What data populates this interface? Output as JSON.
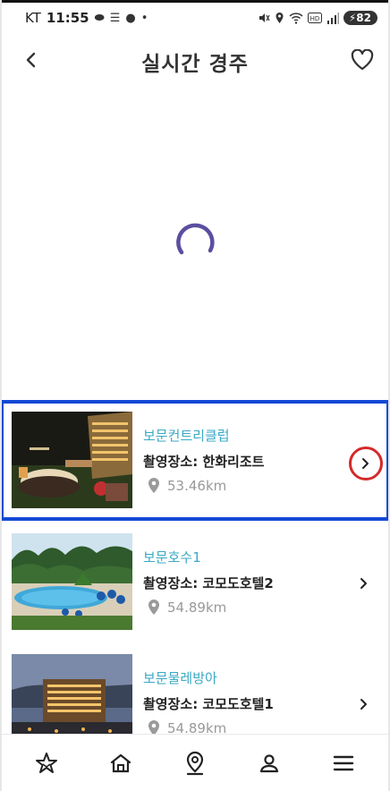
{
  "status_bar": {
    "carrier": "KT",
    "time": "11:55",
    "battery": "82"
  },
  "header": {
    "title": "실시간 경주",
    "back_icon": "chevron-left-icon",
    "favorite_icon": "heart-outline-icon"
  },
  "player": {
    "loading": true,
    "spinner_color": "#5a4fa0"
  },
  "places": [
    {
      "name": "보문컨트리클럽",
      "location": "촬영장소: 한화리조트",
      "distance": "53.46km",
      "selected": true
    },
    {
      "name": "보문호수1",
      "location": "촬영장소: 코모도호텔2",
      "distance": "54.89km",
      "selected": false
    },
    {
      "name": "보문물레방아",
      "location": "촬영장소: 코모도호텔1",
      "distance": "54.89km",
      "selected": false
    }
  ],
  "bottom_nav": [
    {
      "icon": "star-icon"
    },
    {
      "icon": "home-icon"
    },
    {
      "icon": "map-pin-icon"
    },
    {
      "icon": "person-icon"
    },
    {
      "icon": "menu-icon"
    }
  ],
  "colors": {
    "accent": "#3aa9c4",
    "selection_border": "#1449d6",
    "highlight_circle": "#d42a2a"
  }
}
